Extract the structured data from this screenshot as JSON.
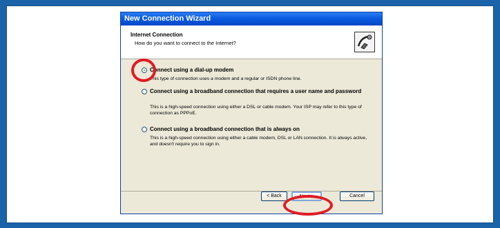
{
  "window": {
    "title": "New Connection Wizard"
  },
  "header": {
    "title": "Internet Connection",
    "subtitle": "How do you want to connect to the Internet?"
  },
  "options": [
    {
      "label": "Connect using a dial-up modem",
      "description": "This type of connection uses a modem and a regular or ISDN phone line.",
      "selected": true
    },
    {
      "label": "Connect using a broadband connection that requires a user name and password",
      "description": "This is a high-speed connection using either a DSL or cable modem. Your ISP may refer to this type of connection as PPPoE.",
      "selected": false
    },
    {
      "label": "Connect using a broadband connection that is always on",
      "description": "This is a high-speed connection using either a cable modem, DSL or LAN connection. It is always active, and doesn't require you to sign in.",
      "selected": false
    }
  ],
  "buttons": {
    "back": "< Back",
    "next": "Next >",
    "cancel": "Cancel"
  },
  "colors": {
    "annotation": "#e01b24",
    "titlebar": "#0a5ce0",
    "frame": "#1b63a8"
  }
}
